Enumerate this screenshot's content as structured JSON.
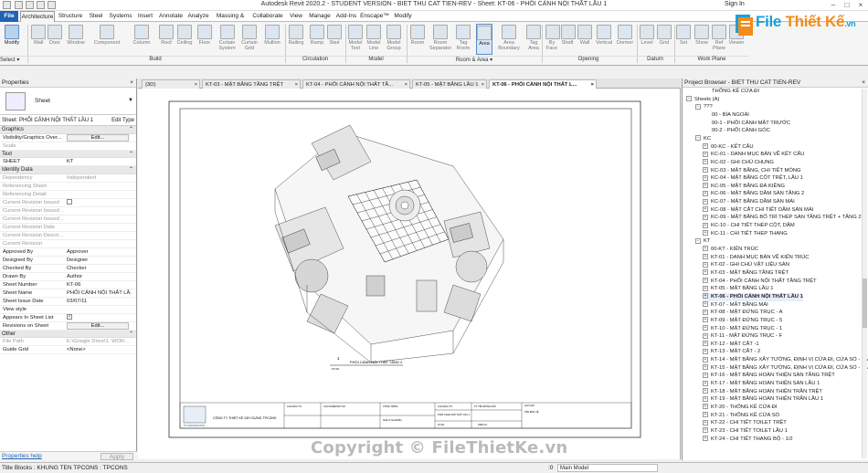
{
  "app_title": "Autodesk Revit 2020.2 - STUDENT VERSION - BIET THU CAT TIEN-REV - Sheet: KT-06 - PHỐI CẢNH NỘI THẤT LẦU 1",
  "signin": "Sign In",
  "menu": [
    "File",
    "Architecture",
    "Structure",
    "Steel",
    "Systems",
    "Insert",
    "Annotate",
    "Analyze",
    "Massing & Site",
    "Collaborate",
    "View",
    "Manage",
    "Add-Ins",
    "Enscape™",
    "Modify"
  ],
  "ribbon": {
    "buttons": [
      "Modify",
      "Wall",
      "Door",
      "Window",
      "Component",
      "Column",
      "Roof",
      "Ceiling",
      "Floor",
      "Curtain System",
      "Curtain Grid",
      "Mullion",
      "Railing",
      "Ramp",
      "Stair",
      "Model Text",
      "Model Line",
      "Model Group",
      "Room",
      "Room Separator",
      "Tag Room",
      "Area",
      "Area Boundary",
      "Tag Area",
      "By Face",
      "Shaft",
      "Wall",
      "Vertical",
      "Dormer",
      "Level",
      "Grid",
      "Set",
      "Show",
      "Ref Plane",
      "Viewer"
    ],
    "groups": [
      "Select ▾",
      "Build",
      "Circulation",
      "Model",
      "Room & Area ▾",
      "Opening",
      "Datum",
      "Work Plane"
    ]
  },
  "logo": {
    "brand": "File",
    "brand2": "Thiết Kế",
    "suffix": ".vn"
  },
  "properties": {
    "title": "Properties",
    "type": "Sheet",
    "sheet_selector": "Sheet: PHỐI CẢNH NỘI THẤT LẦU 1",
    "edit_type": "Edit Type",
    "sections": [
      {
        "name": "Graphics",
        "rows": [
          [
            "Visibility/Graphics Over...",
            "Edit...",
            "btn"
          ],
          [
            "Scale",
            "",
            "dim"
          ]
        ]
      },
      {
        "name": "Text",
        "rows": [
          [
            "SHEET",
            "KT",
            ""
          ]
        ]
      },
      {
        "name": "Identity Data",
        "rows": [
          [
            "Dependency",
            "Independent",
            "dim"
          ],
          [
            "Referencing Sheet",
            "",
            "dim"
          ],
          [
            "Referencing Detail",
            "",
            "dim"
          ],
          [
            "Current Revision Issued",
            "",
            "dimchk"
          ],
          [
            "Current Revision Issued ...",
            "",
            "dim"
          ],
          [
            "Current Revision Issued ...",
            "",
            "dim"
          ],
          [
            "Current Revision Date",
            "",
            "dim"
          ],
          [
            "Current Revision Descri...",
            "",
            "dim"
          ],
          [
            "Current Revision",
            "",
            "dim"
          ],
          [
            "Approved By",
            "Approver",
            ""
          ],
          [
            "Designed By",
            "Designer",
            ""
          ],
          [
            "Checked By",
            "Checker",
            ""
          ],
          [
            "Drawn By",
            "Author",
            ""
          ],
          [
            "Sheet Number",
            "KT-06",
            ""
          ],
          [
            "Sheet Name",
            "PHỐI CẢNH NỘI THẤT LẦ...",
            ""
          ],
          [
            "Sheet Issue Date",
            "03/07/11",
            ""
          ],
          [
            "View style",
            "",
            ""
          ],
          [
            "Appears In Sheet List",
            "✓",
            "chk"
          ],
          [
            "Revisions on Sheet",
            "Edit...",
            "btn"
          ]
        ]
      },
      {
        "name": "Other",
        "rows": [
          [
            "File Path",
            "E:\\Google Drive\\1. WOR...",
            "dim"
          ],
          [
            "Guide Grid",
            "<None>",
            ""
          ]
        ]
      }
    ],
    "help": "Properties help",
    "apply": "Apply"
  },
  "tabs": [
    "{3D}",
    "KT-03 - MẶT BẰNG TẦNG TRỆT",
    "KT-04 - PHỐI CẢNH NỘI THẤT TẦ...",
    "KT-05 - MẶT BẰNG LẦU 1",
    "KT-06 - PHỐI CẢNH NỘI THẤT L..."
  ],
  "sheet": {
    "view_number": "1",
    "view_title": "PHỐI CẢNH NỘI THẤT TẦNG 2",
    "view_ref": "KT-06",
    "company_name": "CÔNG TY THIẾT KẾ XÂY DỰNG TPCONS",
    "logo_label": "TP CONSTRUCTION",
    "tb_cells": [
      "CHỦ ĐẦU TƯ",
      "CHỦ NHIỆM ĐỒ ÁN",
      "CÔNG TRÌNH",
      "CHỦ ĐẦU TƯ",
      "KÝ TÊN ĐÓNG DẤU",
      "GHI CHÚ",
      "NHÀ Ở GIA ĐÌNH",
      "PHỐI CẢNH NỘI THẤT LẦU 1",
      "KT-06",
      "03/07/11",
      "TÊN BẢN VẼ"
    ]
  },
  "browser": {
    "title": "Project Browser - BIET THU CAT TIEN-REV",
    "items": [
      {
        "t": "THỐNG KÊ CỬA ĐI",
        "lvl": 2,
        "exp": ""
      },
      {
        "t": "Sheets (A)",
        "lvl": 0,
        "exp": "−"
      },
      {
        "t": "???",
        "lvl": 1,
        "exp": "−"
      },
      {
        "t": "00 - BÌA NGOÀI",
        "lvl": 2,
        "exp": ""
      },
      {
        "t": "00-1 - PHỐI CẢNH MẶT TRƯỚC",
        "lvl": 2,
        "exp": ""
      },
      {
        "t": "00-2 - PHỐI CẢNH GÓC",
        "lvl": 2,
        "exp": ""
      },
      {
        "t": "KC",
        "lvl": 1,
        "exp": "−"
      },
      {
        "t": "00-KC - KẾT CẤU",
        "lvl": 2,
        "exp": "+"
      },
      {
        "t": "KC-01 - DANH MỤC BẢN VẼ KẾT CẤU",
        "lvl": 2,
        "exp": "+"
      },
      {
        "t": "KC-02 - GHI CHÚ CHUNG",
        "lvl": 2,
        "exp": "+"
      },
      {
        "t": "KC-03 - MẶT BẰNG, CHI TIẾT MÓNG",
        "lvl": 2,
        "exp": "+"
      },
      {
        "t": "KC-04 - MẶT BẰNG CỘT TRỆT, LẦU 1",
        "lvl": 2,
        "exp": "+"
      },
      {
        "t": "KC-05 - MẶT BẰNG ĐÀ KIỀNG",
        "lvl": 2,
        "exp": "+"
      },
      {
        "t": "KC-06 - MẶT BẰNG DẦM SÀN TẦNG 2",
        "lvl": 2,
        "exp": "+"
      },
      {
        "t": "KC-07 - MẶT BẰNG DẦM SÀN MÁI",
        "lvl": 2,
        "exp": "+"
      },
      {
        "t": "KC-08 - MẶT CẮT CHI TIẾT DẦM SÀN MÁI",
        "lvl": 2,
        "exp": "+"
      },
      {
        "t": "KC-09 - MẶT BẰNG BỐ TRÍ THÉP SÀN TẦNG TRỆT + TẦNG 2",
        "lvl": 2,
        "exp": "+"
      },
      {
        "t": "KC-10 - CHI TIẾT THÉP CỘT, DẦM",
        "lvl": 2,
        "exp": "+"
      },
      {
        "t": "KC-11 - CHI TIẾT THÉP THANG",
        "lvl": 2,
        "exp": "+"
      },
      {
        "t": "KT",
        "lvl": 1,
        "exp": "−"
      },
      {
        "t": "00-KT - KIẾN TRÚC",
        "lvl": 2,
        "exp": "+"
      },
      {
        "t": "KT-01 - DANH MỤC BẢN VẼ KIẾN TRÚC",
        "lvl": 2,
        "exp": "+"
      },
      {
        "t": "KT-02 - GHI CHÚ VẬT LIỆU SÀN",
        "lvl": 2,
        "exp": "+"
      },
      {
        "t": "KT-03 - MẶT BẰNG TẦNG TRỆT",
        "lvl": 2,
        "exp": "+"
      },
      {
        "t": "KT-04 - PHỐI CẢNH NỘI THẤT TẦNG TRỆT",
        "lvl": 2,
        "exp": "+"
      },
      {
        "t": "KT-05 - MẶT BẰNG LẦU 1",
        "lvl": 2,
        "exp": "+"
      },
      {
        "t": "KT-06 - PHỐI CẢNH NỘI THẤT LẦU 1",
        "lvl": 2,
        "exp": "+",
        "sel": true
      },
      {
        "t": "KT-07 - MẶT BẰNG MÁI",
        "lvl": 2,
        "exp": "+"
      },
      {
        "t": "KT-08 - MẶT ĐỨNG TRỤC - A",
        "lvl": 2,
        "exp": "+"
      },
      {
        "t": "KT-09 - MẶT ĐỨNG TRỤC - 5",
        "lvl": 2,
        "exp": "+"
      },
      {
        "t": "KT-10 - MẶT ĐỨNG TRỤC - 1",
        "lvl": 2,
        "exp": "+"
      },
      {
        "t": "KT-11 - MẶT ĐỨNG TRỤC - F",
        "lvl": 2,
        "exp": "+"
      },
      {
        "t": "KT-12 - MẶT CẮT -1",
        "lvl": 2,
        "exp": "+"
      },
      {
        "t": "KT-13 - MẶT CẮT - 2",
        "lvl": 2,
        "exp": "+"
      },
      {
        "t": "KT-14 - MẶT BẰNG XÂY TƯỜNG, ĐỊNH VỊ CỬA ĐI, CỬA SỔ - TẦNG TRỆT",
        "lvl": 2,
        "exp": "+"
      },
      {
        "t": "KT-15 - MẶT BẰNG XÂY TƯỜNG, ĐỊNH VỊ CỬA ĐI, CỬA SỔ - LẦU 1",
        "lvl": 2,
        "exp": "+"
      },
      {
        "t": "KT-16 - MẶT BẰNG HOÀN THIỆN SÀN TẦNG TRỆT",
        "lvl": 2,
        "exp": "+"
      },
      {
        "t": "KT-17 - MẶT BẰNG HOÀN THIỆN SÀN LẦU 1",
        "lvl": 2,
        "exp": "+"
      },
      {
        "t": "KT-18 - MẶT BẰNG HOÀN THIỆN TRẦN TRỆT",
        "lvl": 2,
        "exp": "+"
      },
      {
        "t": "KT-19 - MẶT BẰNG HOÀN THIỆN TRẦN LẦU 1",
        "lvl": 2,
        "exp": "+"
      },
      {
        "t": "KT-20 - THỐNG KÊ CỬA ĐI",
        "lvl": 2,
        "exp": "+"
      },
      {
        "t": "KT-21 - THỐNG KÊ CỬA SỔ",
        "lvl": 2,
        "exp": "+"
      },
      {
        "t": "KT-22 - CHI TIẾT TOILET TRỆT",
        "lvl": 2,
        "exp": "+"
      },
      {
        "t": "KT-23 - CHI TIẾT TOILET LẦU 1",
        "lvl": 2,
        "exp": "+"
      },
      {
        "t": "KT-24 - CHI TIẾT THANG BỘ - 1/2",
        "lvl": 2,
        "exp": "+"
      }
    ]
  },
  "status": {
    "text": "Title Blocks : KHUNG TEN TPCONS : TPCONS",
    "model": "Main Model",
    "zero": ":0"
  },
  "watermark": "Copyright © FileThietKe.vn"
}
